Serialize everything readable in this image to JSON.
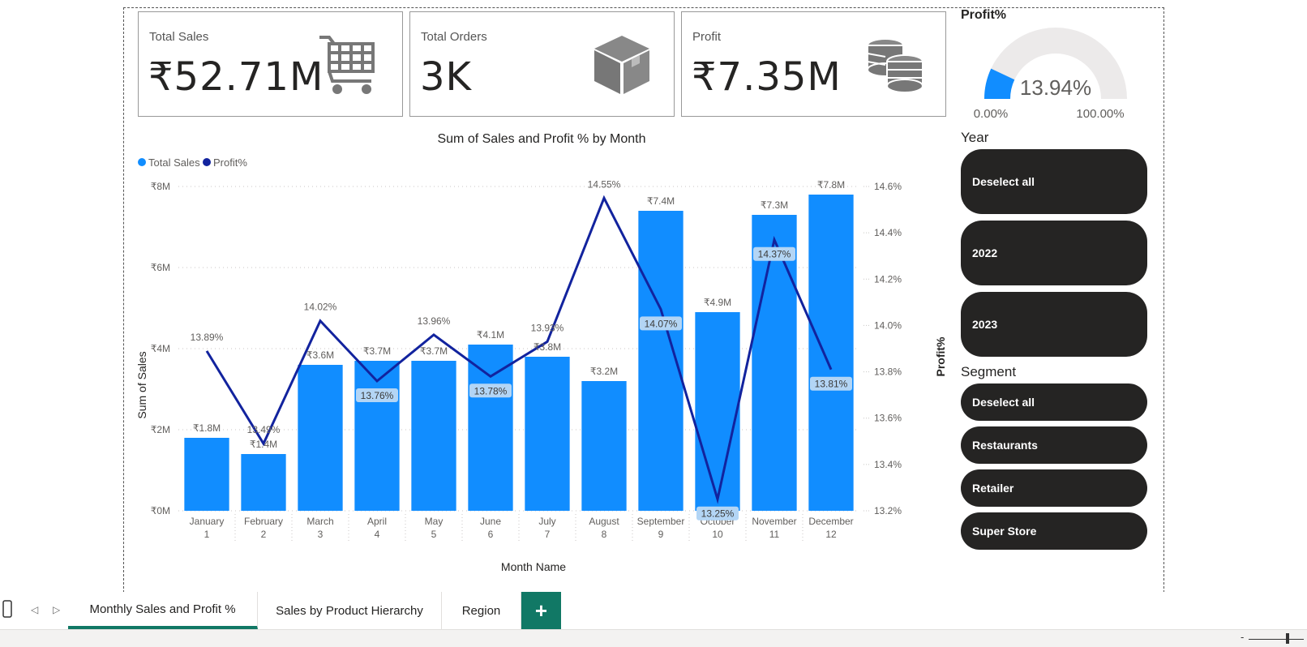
{
  "cards": {
    "total_sales": {
      "label": "Total Sales",
      "value": "₹52.71M"
    },
    "total_orders": {
      "label": "Total Orders",
      "value": "3K"
    },
    "profit": {
      "label": "Profit",
      "value": "₹7.35M"
    }
  },
  "gauge": {
    "title": "Profit%",
    "value": "13.94%",
    "min": "0.00%",
    "max": "100.00%",
    "fraction": 0.1394
  },
  "year_slicer": {
    "title": "Year",
    "items": [
      "Deselect all",
      "2022",
      "2023"
    ]
  },
  "segment_slicer": {
    "title": "Segment",
    "items": [
      "Deselect all",
      "Restaurants",
      "Retailer",
      "Super Store"
    ]
  },
  "tabs": [
    "Monthly Sales and Profit %",
    "Sales by Product Hierarchy",
    "Region"
  ],
  "add_tab_label": "+",
  "zoom_minus": "-",
  "colors": {
    "bar": "#118dff",
    "line": "#12239e",
    "pill": "#252423",
    "tab_accent": "#117865"
  },
  "chart_data": {
    "type": "bar",
    "title": "Sum of Sales and Profit % by Month",
    "xlabel": "Month Name",
    "ylabel": "Sum of Sales",
    "y2label": "Profit%",
    "legend": [
      "Total Sales",
      "Profit%"
    ],
    "legend_position": "top-left",
    "categories": [
      "January",
      "February",
      "March",
      "April",
      "May",
      "June",
      "July",
      "August",
      "September",
      "October",
      "November",
      "December"
    ],
    "category_numbers": [
      "1",
      "2",
      "3",
      "4",
      "5",
      "6",
      "7",
      "8",
      "9",
      "10",
      "11",
      "12"
    ],
    "series": [
      {
        "name": "Total Sales",
        "type": "bar",
        "values": [
          1.8,
          1.4,
          3.6,
          3.7,
          3.7,
          4.1,
          3.8,
          3.2,
          7.4,
          4.9,
          7.3,
          7.8
        ],
        "labels": [
          "₹1.8M",
          "₹1.4M",
          "₹3.6M",
          "₹3.7M",
          "₹3.7M",
          "₹4.1M",
          "₹3.8M",
          "₹3.2M",
          "₹7.4M",
          "₹4.9M",
          "₹7.3M",
          "₹7.8M"
        ]
      },
      {
        "name": "Profit%",
        "type": "line",
        "values": [
          13.89,
          13.49,
          14.02,
          13.76,
          13.96,
          13.78,
          13.93,
          14.55,
          14.07,
          13.25,
          14.37,
          13.81
        ],
        "labels": [
          "13.89%",
          "13.49%",
          "14.02%",
          "13.76%",
          "13.96%",
          "13.78%",
          "13.93%",
          "14.55%",
          "14.07%",
          "13.25%",
          "14.37%",
          "13.81%"
        ]
      }
    ],
    "ylim": [
      0,
      8
    ],
    "yticks": [
      "₹0M",
      "₹2M",
      "₹4M",
      "₹6M",
      "₹8M"
    ],
    "y2lim": [
      13.2,
      14.6
    ],
    "y2ticks": [
      "13.2%",
      "13.4%",
      "13.6%",
      "13.8%",
      "14.0%",
      "14.2%",
      "14.4%",
      "14.6%"
    ],
    "grid": true
  }
}
